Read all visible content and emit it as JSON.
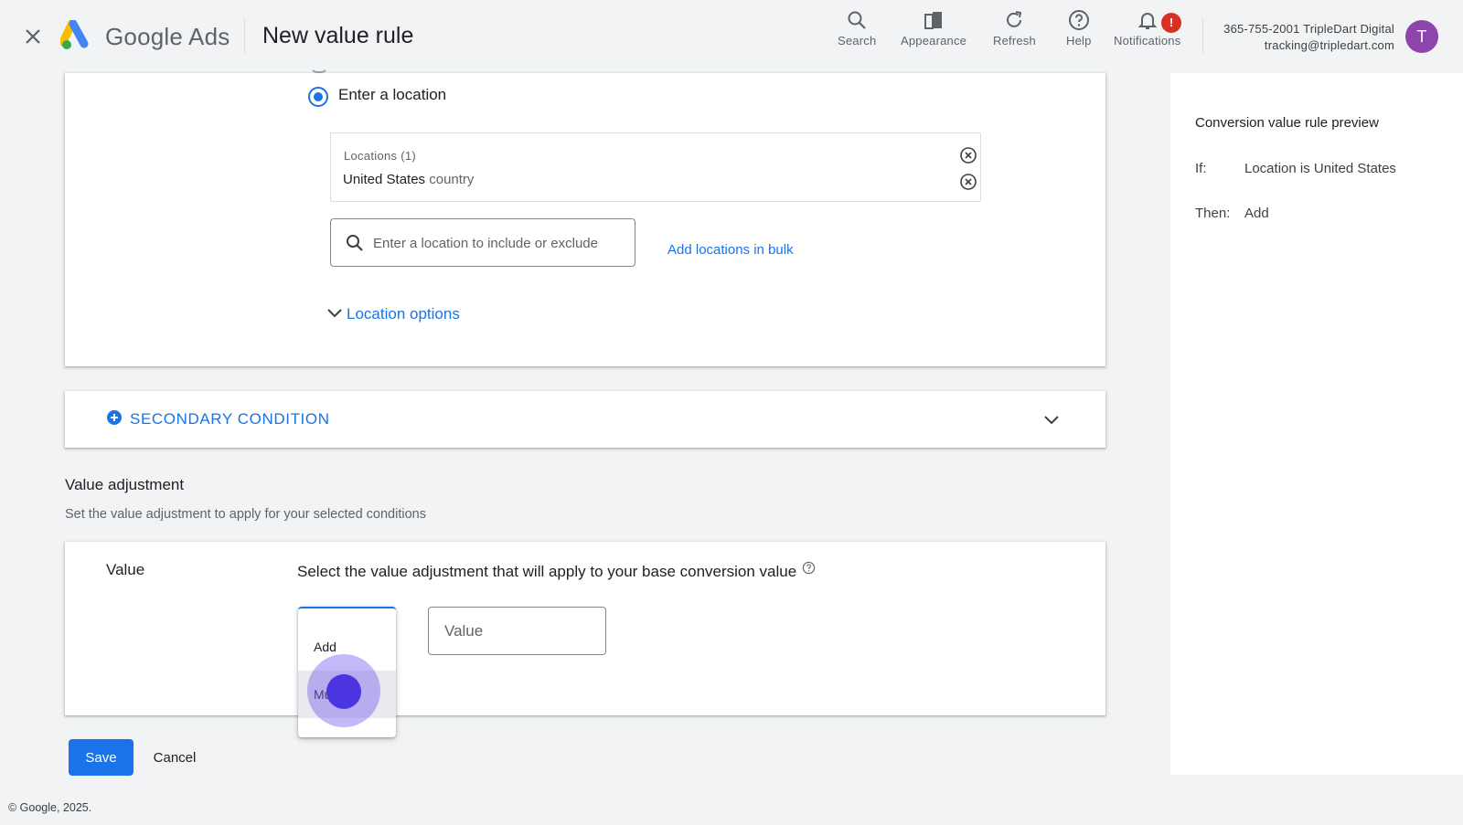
{
  "header": {
    "product_name": "Google Ads",
    "page_title": "New value rule",
    "tools": [
      {
        "label": "Search",
        "icon": "search-icon"
      },
      {
        "label": "Appearance",
        "icon": "appearance-icon"
      },
      {
        "label": "Refresh",
        "icon": "refresh-icon"
      },
      {
        "label": "Help",
        "icon": "help-icon"
      },
      {
        "label": "Notifications",
        "icon": "bell-icon",
        "badge": "!"
      }
    ],
    "account_line1": "365-755-2001 TripleDart Digital",
    "account_line2": "tracking@tripledart.com",
    "avatar_letter": "T"
  },
  "location": {
    "radio_label": "Enter a location",
    "list_title": "Locations (1)",
    "items": [
      {
        "name": "United States",
        "type": "country"
      }
    ],
    "search_placeholder": "Enter a location to include or exclude",
    "bulk_link": "Add locations in bulk",
    "options_label": "Location options"
  },
  "secondary_condition": {
    "label": "SECONDARY CONDITION"
  },
  "value_adjustment": {
    "title": "Value adjustment",
    "description": "Set the value adjustment to apply for your selected conditions",
    "field_label": "Value",
    "question": "Select the value adjustment that will apply to your base conversion value",
    "value_placeholder": "Value",
    "menu_options": [
      "Add",
      "Mu"
    ]
  },
  "actions": {
    "save": "Save",
    "cancel": "Cancel"
  },
  "footer": "© Google, 2025.",
  "preview": {
    "title": "Conversion value rule preview",
    "if_label": "If:",
    "if_value": "Location is United States",
    "then_label": "Then:",
    "then_value": "Add"
  },
  "colors": {
    "accent": "#1a73e8",
    "badge": "#d93025",
    "avatar": "#8e44ad",
    "click_indicator": "#4a35e0"
  }
}
